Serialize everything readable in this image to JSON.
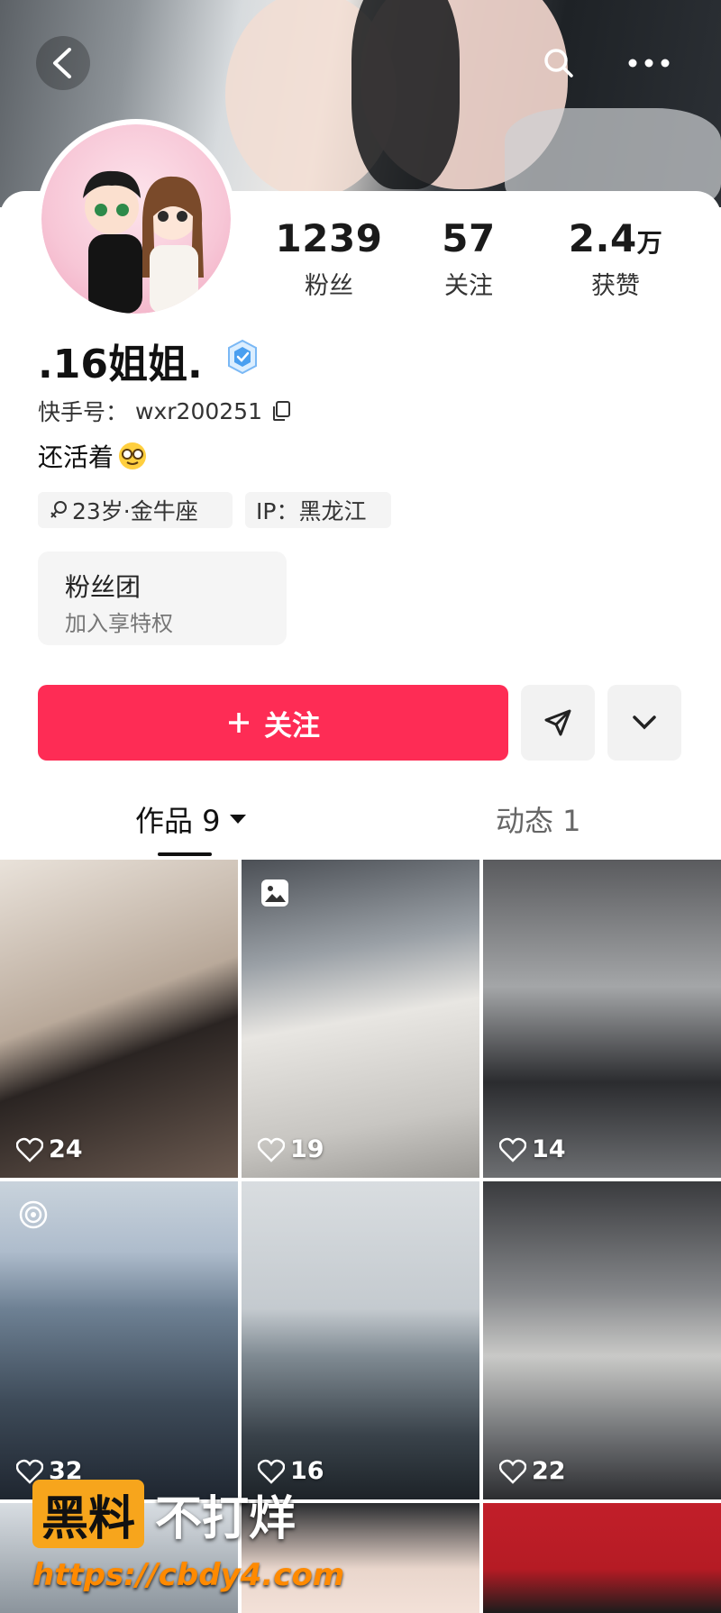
{
  "header": {
    "back_icon": "back-arrow-icon",
    "search_icon": "search-icon",
    "more_icon": "more-dots-icon"
  },
  "profile": {
    "name": ".16姐姐.",
    "kuaishou_id_label": "快手号：",
    "kuaishou_id": "wxr200251",
    "bio": "还活着",
    "tags": [
      "23岁·金牛座",
      "IP：黑龙江"
    ],
    "gender_icon": "female-icon"
  },
  "stats": [
    {
      "value": "1239",
      "unit": "",
      "label": "粉丝"
    },
    {
      "value": "57",
      "unit": "",
      "label": "关注"
    },
    {
      "value": "2.4",
      "unit": "万",
      "label": "获赞"
    }
  ],
  "fanclub": {
    "title": "粉丝团",
    "subtitle": "加入享特权"
  },
  "actions": {
    "follow_label": "关注"
  },
  "tabs": [
    {
      "label": "作品 9",
      "active": true
    },
    {
      "label": "动态 1",
      "active": false
    }
  ],
  "posts": [
    {
      "likes": "24",
      "type": "video"
    },
    {
      "likes": "19",
      "type": "photo"
    },
    {
      "likes": "14",
      "type": "video"
    },
    {
      "likes": "32",
      "type": "live"
    },
    {
      "likes": "16",
      "type": "video"
    },
    {
      "likes": "22",
      "type": "video"
    },
    {
      "likes": "",
      "type": "video"
    },
    {
      "likes": "",
      "type": "video"
    },
    {
      "likes": "",
      "type": "video"
    }
  ],
  "watermark": {
    "badge": "黑料",
    "text": "不打烊",
    "url": "https://cbdy4.com"
  },
  "colors": {
    "accent": "#fe2c55",
    "watermark_orange": "#f7a51c"
  }
}
